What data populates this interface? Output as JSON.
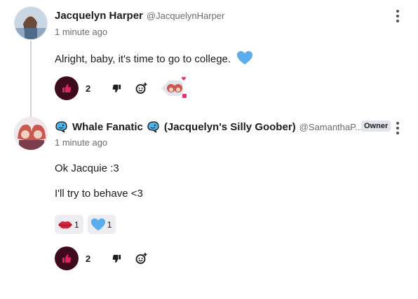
{
  "comments": [
    {
      "display_name": "Jacquelyn Harper",
      "handle": "@JacquelynHarper",
      "timestamp": "1 minute ago",
      "lines": [
        "Alright, baby, it's time to go to college."
      ],
      "body_icon": "blue-heart-icon",
      "likes": "2"
    },
    {
      "display_name_part1": "Whale Fanatic",
      "display_name_part2": "(Jacquelyn's Silly Goober)",
      "name_icon": "whale-icon",
      "handle": "@SamanthaP...",
      "badge": "Owner",
      "timestamp": "1 minute ago",
      "lines": [
        "Ok Jacquie :3",
        "I'll try to behave <3"
      ],
      "reactions": [
        {
          "icon": "lips-kiss-icon",
          "count": "1"
        },
        {
          "icon": "blue-heart-icon",
          "count": "1"
        }
      ],
      "likes": "2"
    }
  ],
  "colors": {
    "like_button_bg": "#3d0a1e",
    "like_icon": "#e0245e",
    "blue_heart": "#5dadec",
    "thread_line": "#d4d4d8",
    "badge_bg": "#e4e4ec"
  }
}
